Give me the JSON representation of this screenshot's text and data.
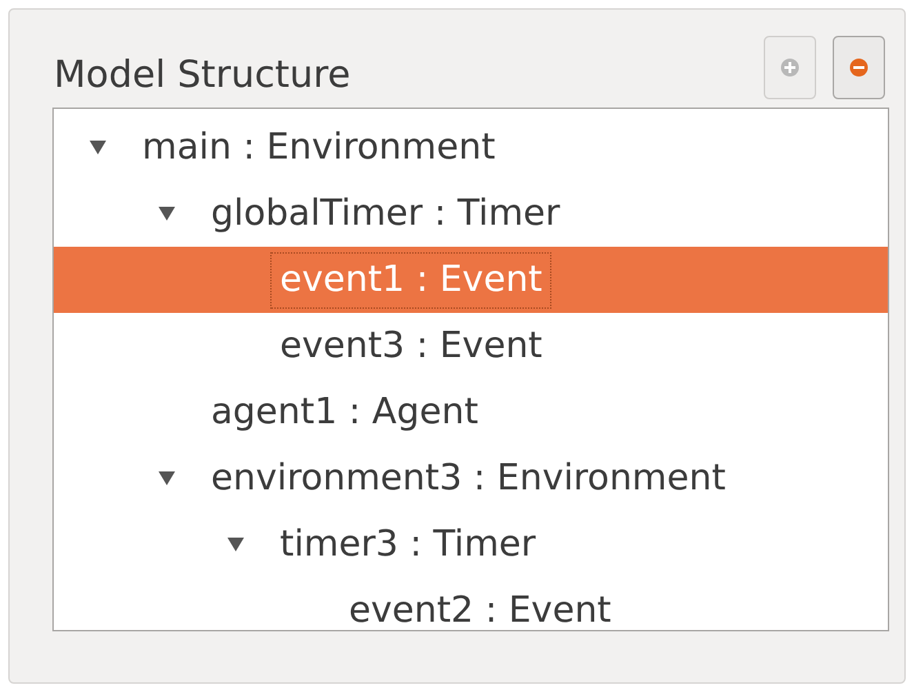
{
  "panel": {
    "title": "Model Structure"
  },
  "toolbar": [
    {
      "kind": "add",
      "disabled": true
    },
    {
      "kind": "remove",
      "disabled": false
    }
  ],
  "tree": [
    {
      "label": "main : Environment",
      "expanded": true,
      "selected": false,
      "children": [
        {
          "label": "globalTimer : Timer",
          "expanded": true,
          "selected": false,
          "children": [
            {
              "label": "event1 : Event",
              "selected": true
            },
            {
              "label": "event3 : Event",
              "selected": false
            }
          ]
        },
        {
          "label": "agent1 : Agent",
          "selected": false
        },
        {
          "label": "environment3 : Environment",
          "expanded": true,
          "selected": false,
          "children": [
            {
              "label": "timer3 : Timer",
              "expanded": true,
              "selected": false,
              "children": [
                {
                  "label": "event2 : Event",
                  "selected": false
                }
              ]
            }
          ]
        }
      ]
    }
  ]
}
